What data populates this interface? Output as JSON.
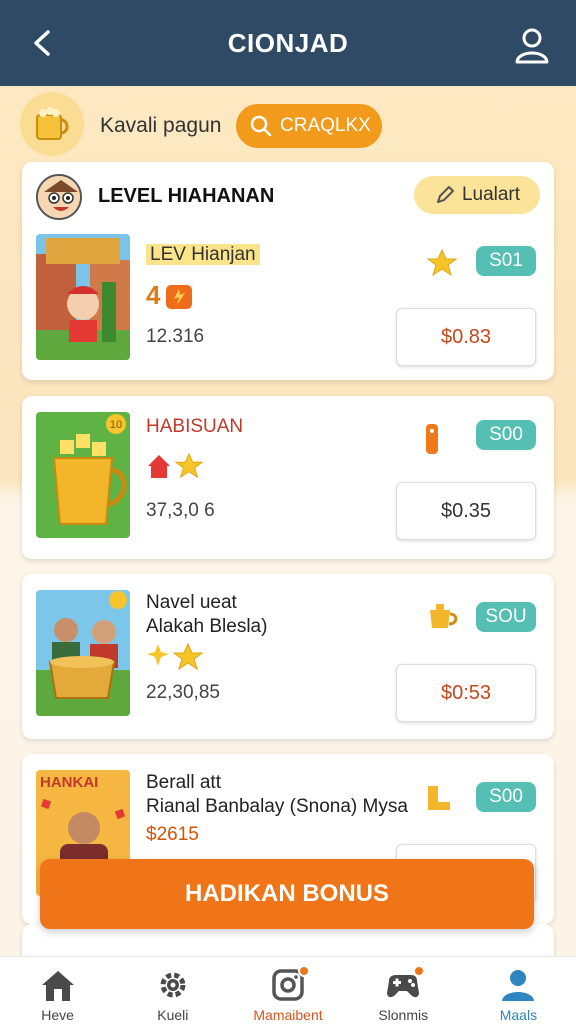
{
  "header": {
    "title": "CIONJAD"
  },
  "strip": {
    "label": "Kavali pagun",
    "search_label": "CRAQLKX"
  },
  "section": {
    "title": "LEVEL HIAHANAN",
    "pill_label": "Lualart"
  },
  "items": [
    {
      "name": "LEV Hianjan",
      "badge": "4",
      "count": "12.316",
      "tag": "S01",
      "price": "$0.83"
    },
    {
      "name": "HABISUAN",
      "count": "37,3,0 6",
      "tag": "S00",
      "price": "$0.35"
    },
    {
      "name": "Navel ueat",
      "sub": "Alakah Blesla)",
      "count": "22,30,85",
      "tag": "SOU",
      "price": "$0:53"
    },
    {
      "name": "Berall att",
      "sub": "Rianal Banbalay (Snona) Mysa",
      "count": "$2615",
      "tag": "S00",
      "thumb_label": "HANKAI"
    }
  ],
  "cta": {
    "label": "HADIKAN BONUS"
  },
  "nav": [
    {
      "label": "Heve",
      "icon": "home-icon",
      "color": "#444444"
    },
    {
      "label": "Kueli",
      "icon": "gear-icon",
      "color": "#444444"
    },
    {
      "label": "Mamaibent",
      "icon": "camera-icon",
      "color": "#d9541e"
    },
    {
      "label": "Slonmis",
      "icon": "gamepad-icon",
      "color": "#444444"
    },
    {
      "label": "Maals",
      "icon": "profile-icon",
      "color": "#2e86c1"
    }
  ],
  "colors": {
    "header": "#2f4a64",
    "accent": "#f07418",
    "tag": "#56bfb3",
    "price_text": "#c6471c"
  }
}
